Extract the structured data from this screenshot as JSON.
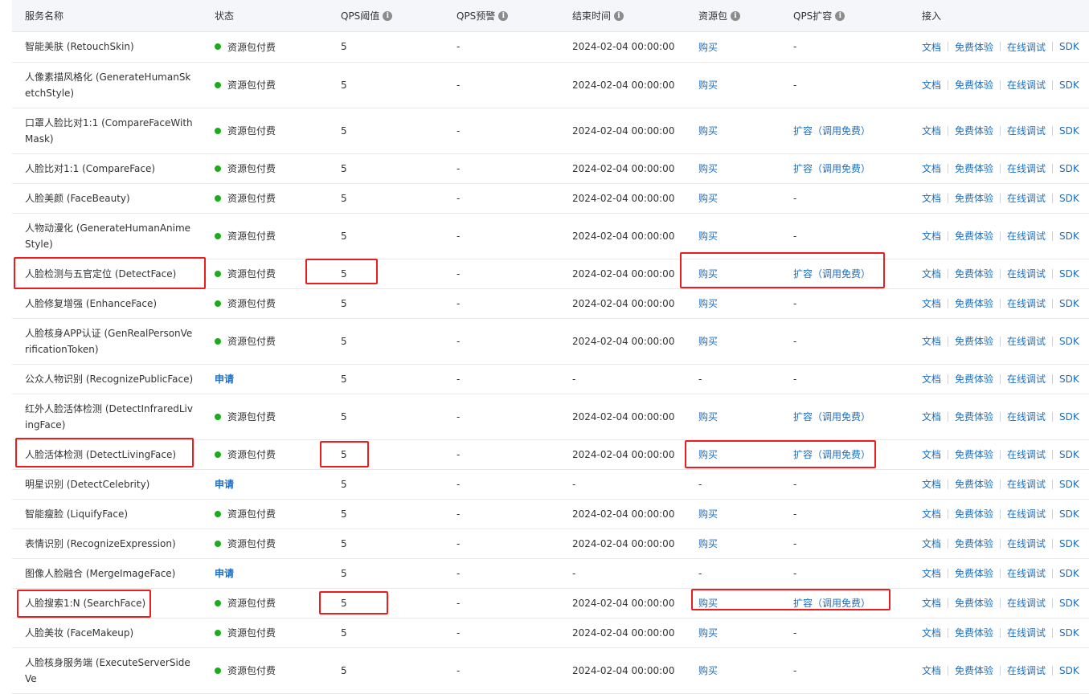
{
  "header": {
    "name": "服务名称",
    "status": "状态",
    "qps_threshold": "QPS阈值",
    "qps_warning": "QPS预警",
    "end_time": "结束时间",
    "resource_pkg": "资源包",
    "qps_expand": "QPS扩容",
    "access": "接入",
    "info_icon": "i"
  },
  "access_links": {
    "doc": "文档",
    "trial": "免费体验",
    "debug": "在线调试",
    "sdk": "SDK"
  },
  "rows": [
    {
      "name": "智能美肤 (RetouchSkin)",
      "status": "资源包付费",
      "status_type": "paid",
      "qps": "5",
      "warn": "-",
      "end": "2024-02-04 00:00:00",
      "pkg": "购买",
      "pkg_link": true,
      "exp": "-",
      "exp_link": false
    },
    {
      "name": "人像素描风格化 (GenerateHumanSketchStyle)",
      "status": "资源包付费",
      "status_type": "paid",
      "qps": "5",
      "warn": "-",
      "end": "2024-02-04 00:00:00",
      "pkg": "购买",
      "pkg_link": true,
      "exp": "-",
      "exp_link": false
    },
    {
      "name": "口罩人脸比对1:1 (CompareFaceWithMask)",
      "status": "资源包付费",
      "status_type": "paid",
      "qps": "5",
      "warn": "-",
      "end": "2024-02-04 00:00:00",
      "pkg": "购买",
      "pkg_link": true,
      "exp": "扩容（调用免费）",
      "exp_link": true
    },
    {
      "name": "人脸比对1:1 (CompareFace)",
      "status": "资源包付费",
      "status_type": "paid",
      "qps": "5",
      "warn": "-",
      "end": "2024-02-04 00:00:00",
      "pkg": "购买",
      "pkg_link": true,
      "exp": "扩容（调用免费）",
      "exp_link": true
    },
    {
      "name": "人脸美颜 (FaceBeauty)",
      "status": "资源包付费",
      "status_type": "paid",
      "qps": "5",
      "warn": "-",
      "end": "2024-02-04 00:00:00",
      "pkg": "购买",
      "pkg_link": true,
      "exp": "-",
      "exp_link": false
    },
    {
      "name": "人物动漫化 (GenerateHumanAnimeStyle)",
      "status": "资源包付费",
      "status_type": "paid",
      "qps": "5",
      "warn": "-",
      "end": "2024-02-04 00:00:00",
      "pkg": "购买",
      "pkg_link": true,
      "exp": "-",
      "exp_link": false
    },
    {
      "name": "人脸检测与五官定位 (DetectFace)",
      "status": "资源包付费",
      "status_type": "paid",
      "qps": "5",
      "warn": "-",
      "end": "2024-02-04 00:00:00",
      "pkg": "购买",
      "pkg_link": true,
      "exp": "扩容（调用免费）",
      "exp_link": true
    },
    {
      "name": "人脸修复增强 (EnhanceFace)",
      "status": "资源包付费",
      "status_type": "paid",
      "qps": "5",
      "warn": "-",
      "end": "2024-02-04 00:00:00",
      "pkg": "购买",
      "pkg_link": true,
      "exp": "-",
      "exp_link": false
    },
    {
      "name": "人脸核身APP认证 (GenRealPersonVerificationToken)",
      "status": "资源包付费",
      "status_type": "paid",
      "qps": "5",
      "warn": "-",
      "end": "2024-02-04 00:00:00",
      "pkg": "购买",
      "pkg_link": true,
      "exp": "-",
      "exp_link": false
    },
    {
      "name": "公众人物识别 (RecognizePublicFace)",
      "status": "申请",
      "status_type": "apply",
      "qps": "5",
      "warn": "-",
      "end": "-",
      "pkg": "-",
      "pkg_link": false,
      "exp": "-",
      "exp_link": false
    },
    {
      "name": "红外人脸活体检测 (DetectInfraredLivingFace)",
      "status": "资源包付费",
      "status_type": "paid",
      "qps": "5",
      "warn": "-",
      "end": "2024-02-04 00:00:00",
      "pkg": "购买",
      "pkg_link": true,
      "exp": "扩容（调用免费）",
      "exp_link": true
    },
    {
      "name": "人脸活体检测 (DetectLivingFace)",
      "status": "资源包付费",
      "status_type": "paid",
      "qps": "5",
      "warn": "-",
      "end": "2024-02-04 00:00:00",
      "pkg": "购买",
      "pkg_link": true,
      "exp": "扩容（调用免费）",
      "exp_link": true
    },
    {
      "name": "明星识别 (DetectCelebrity)",
      "status": "申请",
      "status_type": "apply",
      "qps": "5",
      "warn": "-",
      "end": "-",
      "pkg": "-",
      "pkg_link": false,
      "exp": "-",
      "exp_link": false
    },
    {
      "name": "智能瘦脸 (LiquifyFace)",
      "status": "资源包付费",
      "status_type": "paid",
      "qps": "5",
      "warn": "-",
      "end": "2024-02-04 00:00:00",
      "pkg": "购买",
      "pkg_link": true,
      "exp": "-",
      "exp_link": false
    },
    {
      "name": "表情识别 (RecognizeExpression)",
      "status": "资源包付费",
      "status_type": "paid",
      "qps": "5",
      "warn": "-",
      "end": "2024-02-04 00:00:00",
      "pkg": "购买",
      "pkg_link": true,
      "exp": "-",
      "exp_link": false
    },
    {
      "name": "图像人脸融合 (MergeImageFace)",
      "status": "申请",
      "status_type": "apply",
      "qps": "5",
      "warn": "-",
      "end": "-",
      "pkg": "-",
      "pkg_link": false,
      "exp": "-",
      "exp_link": false
    },
    {
      "name": "人脸搜索1:N (SearchFace)",
      "status": "资源包付费",
      "status_type": "paid",
      "qps": "5",
      "warn": "-",
      "end": "2024-02-04 00:00:00",
      "pkg": "购买",
      "pkg_link": true,
      "exp": "扩容（调用免费）",
      "exp_link": true
    },
    {
      "name": "人脸美妆 (FaceMakeup)",
      "status": "资源包付费",
      "status_type": "paid",
      "qps": "5",
      "warn": "-",
      "end": "2024-02-04 00:00:00",
      "pkg": "购买",
      "pkg_link": true,
      "exp": "-",
      "exp_link": false
    },
    {
      "name": "人脸核身服务端 (ExecuteServerSideVe",
      "status": "资源包付费",
      "status_type": "paid",
      "qps": "5",
      "warn": "-",
      "end": "2024-02-04 00:00:00",
      "pkg": "购买",
      "pkg_link": true,
      "exp": "-",
      "exp_link": false
    }
  ]
}
